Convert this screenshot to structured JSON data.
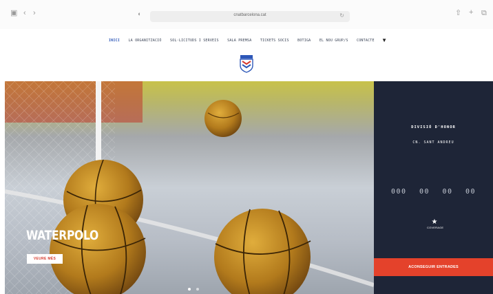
{
  "browser": {
    "url": "cnatbarcelona.cat",
    "icons": [
      "sidebar-icon",
      "back-icon",
      "forward-icon",
      "privacy-icon",
      "reload-icon",
      "share-icon",
      "new-tab-icon",
      "tabs-icon"
    ]
  },
  "nav": {
    "items": [
      "INICI",
      "LA ORGANITZACIÓ",
      "SOL·LICITUDS I SERVEIS",
      "SALA PREMSA",
      "TICKETS SOCIS",
      "BOTIGA",
      "EL NOU GRUP/S",
      "CONTACTE"
    ],
    "active_index": 0,
    "cart_icon": "cart-icon"
  },
  "hero": {
    "title": "WATERPOLO",
    "button_label": "VEURE MÉS",
    "slides": 2,
    "active_slide": 1
  },
  "panel": {
    "title": "DIVISIÓ D'HONOR",
    "subtitle": "CN. SANT ANDREU",
    "countdown": [
      "000",
      "00",
      "00",
      "00"
    ],
    "sponsor_name": "COVERAGE",
    "buy_label": "ACONSEGUIR ENTRADES"
  },
  "colors": {
    "accent_blue": "#2d57b8",
    "panel_bg": "#1e2537",
    "buy_red": "#e4422b"
  }
}
